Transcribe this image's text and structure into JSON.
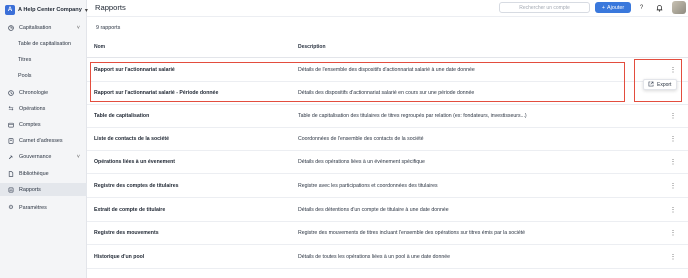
{
  "sidebar": {
    "company": {
      "logo_letter": "A",
      "name": "A Help Center Company"
    },
    "items": [
      {
        "label": "Capitalisation",
        "icon": "pie-chart-icon"
      },
      {
        "label": "Table de capitalisation"
      },
      {
        "label": "Titres"
      },
      {
        "label": "Pools"
      },
      {
        "label": "Chronologie",
        "icon": "timeline-icon"
      },
      {
        "label": "Opérations",
        "icon": "transfer-icon"
      },
      {
        "label": "Comptes",
        "icon": "wallet-icon"
      },
      {
        "label": "Carnet d'adresses",
        "icon": "address-book-icon"
      },
      {
        "label": "Gouvernance",
        "icon": "gavel-icon"
      },
      {
        "label": "Bibliothèque",
        "icon": "file-icon"
      },
      {
        "label": "Rapports",
        "icon": "report-icon",
        "active": true
      },
      {
        "label": "Paramètres",
        "icon": "gear-icon"
      }
    ]
  },
  "header": {
    "title": "Rapports",
    "search_placeholder": "Rechercher un compte",
    "add_label": "Ajouter",
    "help_label": "?"
  },
  "count_label": "9 rapports",
  "table": {
    "headers": {
      "name": "Nom",
      "description": "Description"
    },
    "rows": [
      {
        "name": "Rapport sur l'actionnariat salarié",
        "description": "Détails de l'ensemble des dispositifs d'actionnariat salarié à une date donnée"
      },
      {
        "name": "Rapport sur l'actionnariat salarié - Période donnée",
        "description": "Détails des dispositifs d'actionnariat salarié en cours sur une période donnée"
      },
      {
        "name": "Table de capitalisation",
        "description": "Table de capitalisation des titulaires de titres regroupés par relation (ex: fondateurs, investisseurs...)"
      },
      {
        "name": "Liste de contacts de la société",
        "description": "Coordonnées de l'ensemble des contacts de la société"
      },
      {
        "name": "Opérations liées à un évenement",
        "description": "Détails des opérations liées à un évènement spécifique"
      },
      {
        "name": "Registre des comptes de titulaires",
        "description": "Registre avec les participations et coordonnées des titulaires"
      },
      {
        "name": "Extrait de compte de titulaire",
        "description": "Détails des détentions d'un compte de titulaire à une date donnée"
      },
      {
        "name": "Registre des mouvements",
        "description": "Registre des mouvements de titres incluant l'ensemble des opérations sur titres émis par la société"
      },
      {
        "name": "Historique d'un pool",
        "description": "Détails de toutes les opérations liées à un pool à une date donnée"
      }
    ]
  },
  "context_menu": {
    "export_label": "Export",
    "icon": "export-icon"
  },
  "colors": {
    "accent": "#3a78dc",
    "highlight": "#e34d3e"
  }
}
